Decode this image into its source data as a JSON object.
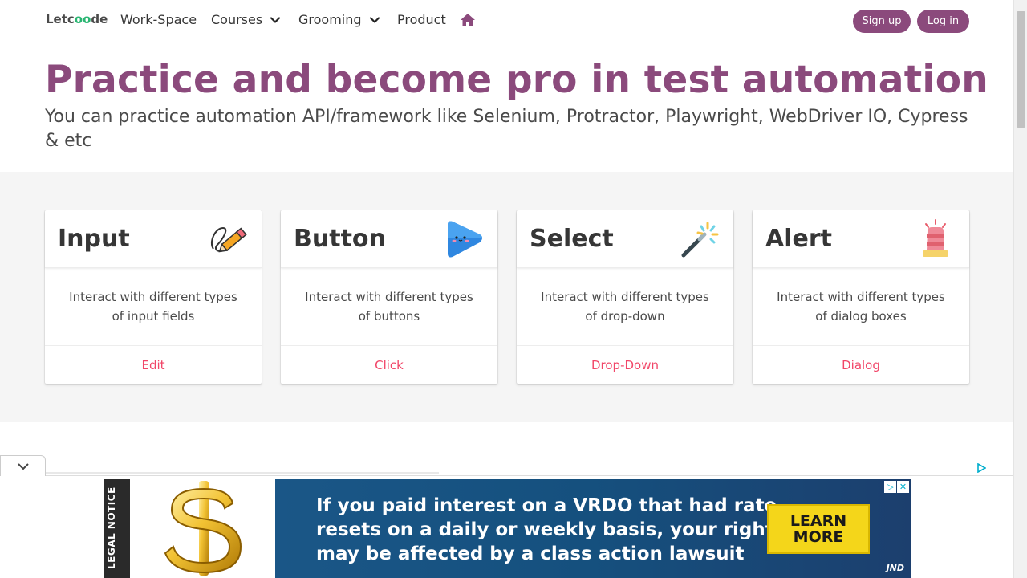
{
  "nav": {
    "logo_a": "Letc",
    "logo_oo": "oo",
    "logo_b": "de",
    "items": [
      {
        "label": "Work-Space"
      },
      {
        "label": "Courses"
      },
      {
        "label": "Grooming"
      },
      {
        "label": "Product"
      }
    ],
    "signup": "Sign up",
    "login": "Log in"
  },
  "hero": {
    "title": "Practice and become pro in test automation",
    "subtitle": "You can practice automation API/framework like Selenium, Protractor, Playwright, WebDriver IO, Cypress & etc"
  },
  "cards": [
    {
      "title": "Input",
      "desc": "Interact with different types of input fields",
      "link": "Edit",
      "icon": "pencil-icon"
    },
    {
      "title": "Button",
      "desc": "Interact with different types of buttons",
      "link": "Click",
      "icon": "play-button-icon"
    },
    {
      "title": "Select",
      "desc": "Interact with different types of drop-down",
      "link": "Drop-Down",
      "icon": "magic-wand-icon"
    },
    {
      "title": "Alert",
      "desc": "Interact with different types of dialog boxes",
      "link": "Dialog",
      "icon": "siren-icon"
    }
  ],
  "ad": {
    "legal": "LEGAL NOTICE",
    "line1": "If you paid interest on a VRDO that had rate",
    "line2": "resets on a daily or weekly basis, your rights",
    "line3": "may be affected by a class action lawsuit",
    "cta1": "LEARN",
    "cta2": "MORE",
    "brand": "JND"
  },
  "colors": {
    "brand": "#8b4a7c",
    "link": "#f14668",
    "section_bg": "#f5f5f5"
  }
}
